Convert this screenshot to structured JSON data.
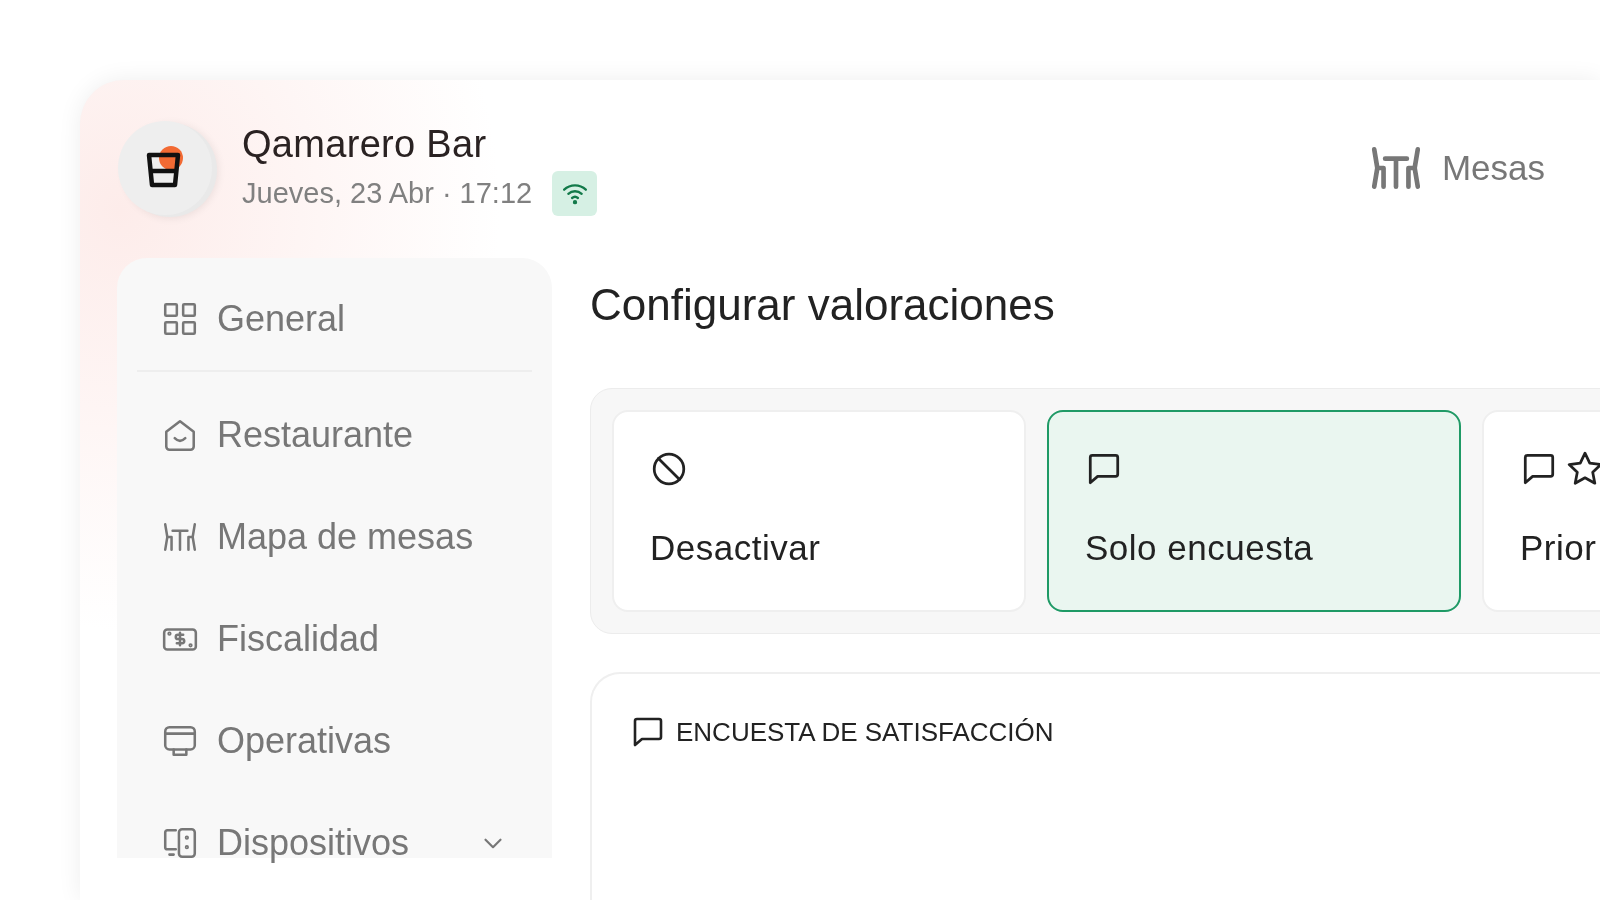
{
  "header": {
    "title": "Qamarero Bar",
    "subtitle": "Jueves, 23 Abr · 17:12",
    "online": true,
    "tables_button": "Mesas"
  },
  "sidebar": {
    "items": [
      {
        "label": "General"
      },
      {
        "label": "Restaurante"
      },
      {
        "label": "Mapa de mesas"
      },
      {
        "label": "Fiscalidad"
      },
      {
        "label": "Operativas"
      },
      {
        "label": "Dispositivos",
        "expanded": false
      }
    ]
  },
  "main": {
    "title": "Configurar valoraciones",
    "options": [
      {
        "label": "Desactivar",
        "selected": false
      },
      {
        "label": "Solo encuesta",
        "selected": true
      },
      {
        "label": "Prior",
        "selected": false
      }
    ],
    "section": {
      "title": "ENCUESTA DE SATISFACCIÓN"
    }
  }
}
